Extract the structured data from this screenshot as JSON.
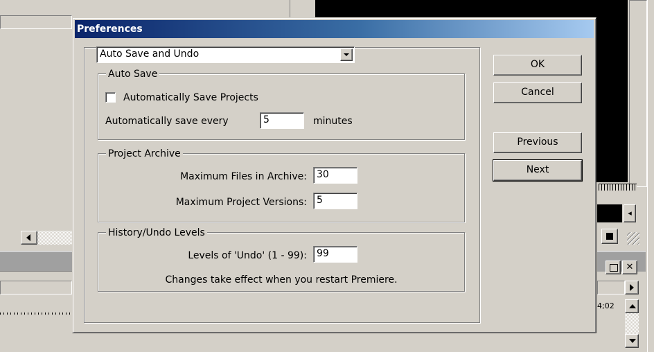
{
  "dialog": {
    "title": "Preferences",
    "category_select": "Auto Save and Undo",
    "auto_save": {
      "legend": "Auto Save",
      "checkbox_label": "Automatically Save Projects",
      "checked": false,
      "every_label": "Automatically save every",
      "every_value": "5",
      "minutes_label": "minutes"
    },
    "project_archive": {
      "legend": "Project Archive",
      "max_files_label": "Maximum Files in Archive:",
      "max_files_value": "30",
      "max_versions_label": "Maximum Project Versions:",
      "max_versions_value": "5"
    },
    "history": {
      "legend": "History/Undo Levels",
      "levels_label": "Levels of 'Undo' (1 - 99):",
      "levels_value": "99",
      "note": "Changes take effect when you restart Premiere."
    },
    "buttons": {
      "ok": "OK",
      "cancel": "Cancel",
      "previous": "Previous",
      "next": "Next"
    }
  },
  "background": {
    "timecode": "4;02"
  }
}
